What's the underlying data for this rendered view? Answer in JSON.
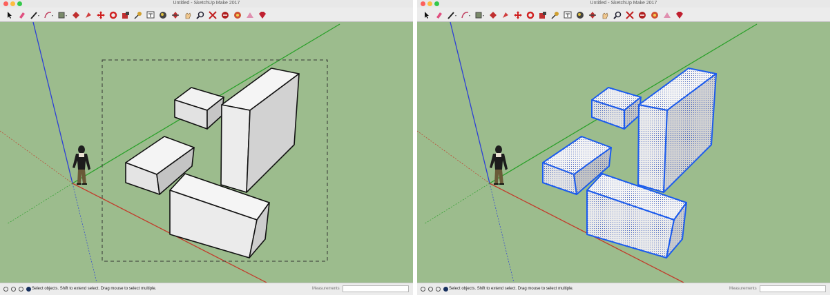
{
  "window_title": "Untitled - SketchUp Make 2017",
  "status_hint": "Select objects. Shift to extend select. Drag mouse to select multiple.",
  "measurements_label": "Measurements",
  "measurements_value": "",
  "toolbar_icons": [
    "select-arrow-icon",
    "eraser-icon",
    "pencil-line-icon",
    "arc-icon",
    "rectangle-icon",
    "push-pull-icon",
    "follow-me-icon",
    "move-icon",
    "rotate-icon",
    "scale-icon",
    "tape-measure-icon",
    "text-icon",
    "paint-bucket-icon",
    "orbit-icon",
    "pan-icon",
    "zoom-icon",
    "zoom-extents-icon",
    "3d-warehouse-icon",
    "extension-warehouse-icon",
    "layout-icon",
    "ruby-icon"
  ],
  "colors": {
    "background": "#9cbc8d",
    "axis_blue": "#2c3fd6",
    "axis_green": "#2aa02a",
    "axis_red": "#c23b2b",
    "selection_highlight": "#1a5cf0"
  },
  "panels": [
    {
      "state": "drag-selecting",
      "selection_rectangle": true,
      "boxes_selected": false
    },
    {
      "state": "objects-selected",
      "selection_rectangle": false,
      "boxes_selected": true
    }
  ]
}
